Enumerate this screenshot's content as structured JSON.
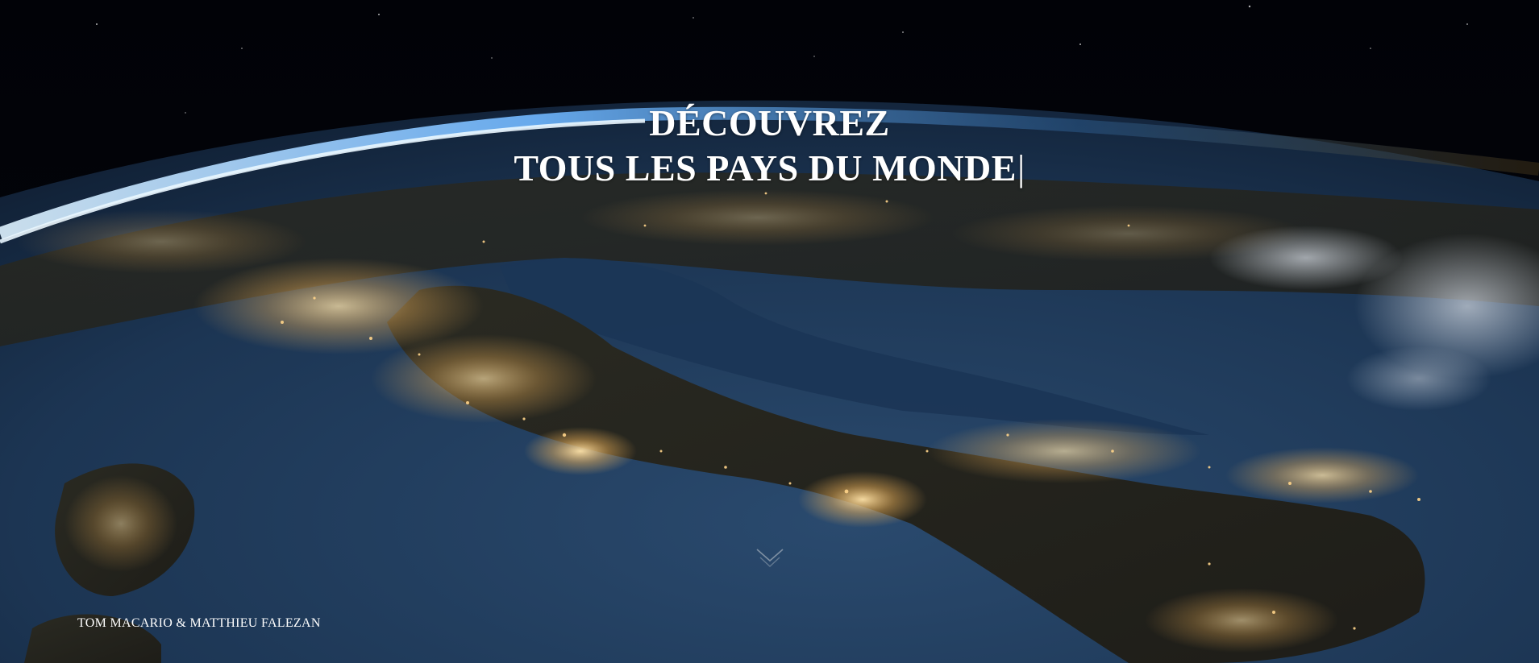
{
  "hero": {
    "title_line_1": "DÉCOUVREZ",
    "title_line_2": "TOUS LES PAYS DU MONDE",
    "caret": "|",
    "scroll_icon": "chevron-down-icon",
    "credits": "TOM MACARIO & MATTHIEU FALEZAN"
  },
  "colors": {
    "text": "#ffffff",
    "space": "#02040a",
    "ocean": "#1f3a5c",
    "city_lights": "#ffcf7a",
    "atmosphere": "#6fb7ff"
  }
}
